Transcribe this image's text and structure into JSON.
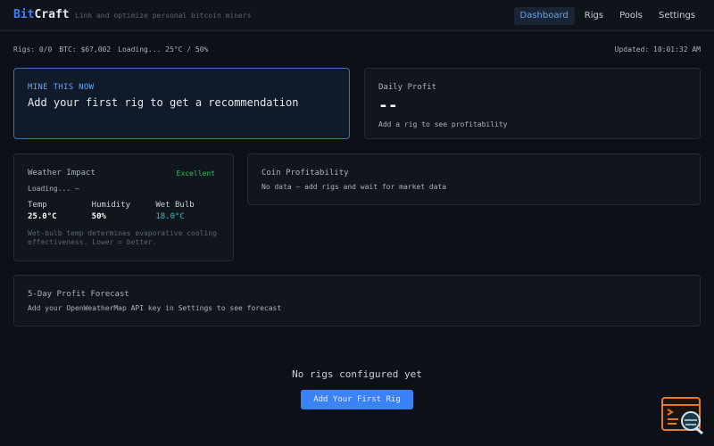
{
  "header": {
    "brand_part1": "Bit",
    "brand_part2": "Craft",
    "tagline": "Link and optimize personal bitcoin miners",
    "nav": [
      "Dashboard",
      "Rigs",
      "Pools",
      "Settings"
    ],
    "active_nav": "Dashboard"
  },
  "status": {
    "rigs": "Rigs: 0/0",
    "btc": "BTC: $67,002",
    "loading": "Loading... 25°C / 50%",
    "updated": "Updated: 10:01:32 AM"
  },
  "mine_now": {
    "label": "MINE THIS NOW",
    "message": "Add your first rig to get a recommendation"
  },
  "daily_profit": {
    "title": "Daily Profit",
    "value": "--",
    "note": "Add a rig to see profitability"
  },
  "weather": {
    "title": "Weather Impact",
    "badge": "Excellent",
    "loading": "Loading... —",
    "temp_label": "Temp",
    "temp_value": "25.0°C",
    "humidity_label": "Humidity",
    "humidity_value": "50%",
    "wetbulb_label": "Wet Bulb",
    "wetbulb_value": "18.0°C",
    "note": "Wet-bulb temp determines evaporative cooling effectiveness. Lower = better."
  },
  "coin_profitability": {
    "title": "Coin Profitability",
    "note": "No data — add rigs and wait for market data"
  },
  "forecast": {
    "title": "5-Day Profit Forecast",
    "note": "Add your OpenWeatherMap API key in Settings to see forecast"
  },
  "empty_state": {
    "title": "No rigs configured yet",
    "button": "Add Your First Rig"
  },
  "colors": {
    "accent": "#3b82f6",
    "success": "#22c55e",
    "teal": "#22c5c5"
  },
  "icons": {
    "corner": "console-search-icon"
  }
}
